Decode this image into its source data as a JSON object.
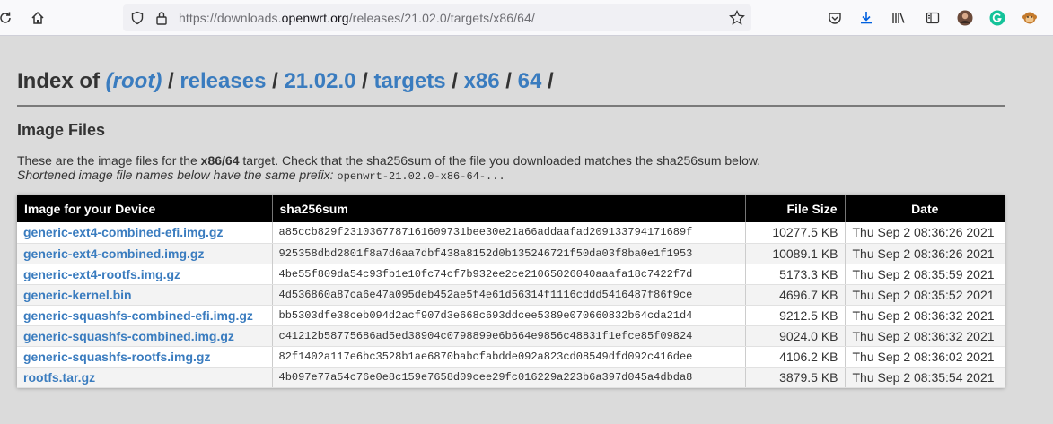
{
  "browser": {
    "url_prefix": "https://downloads.",
    "url_domain": "openwrt.org",
    "url_path": "/releases/21.02.0/targets/x86/64/"
  },
  "page": {
    "heading_prefix": "Index of ",
    "crumbs": [
      "(root)",
      "releases",
      "21.02.0",
      "targets",
      "x86",
      "64"
    ],
    "separator": " / ",
    "trailing": " /",
    "section_title": "Image Files",
    "desc_pre": "These are the image files for the ",
    "desc_target": "x86/64",
    "desc_post": " target. Check that the sha256sum of the file you downloaded matches the sha256sum below.",
    "desc_sub": "Shortened image file names below have the same prefix: ",
    "desc_prefix_code": "openwrt-21.02.0-x86-64-..."
  },
  "table": {
    "headers": {
      "device": "Image for your Device",
      "sha": "sha256sum",
      "size": "File Size",
      "date": "Date"
    },
    "rows": [
      {
        "name": "generic-ext4-combined-efi.img.gz",
        "sha": "a85ccb829f2310367787161609731bee30e21a66addaafad209133794171689f",
        "size": "10277.5 KB",
        "date": "Thu Sep 2 08:36:26 2021"
      },
      {
        "name": "generic-ext4-combined.img.gz",
        "sha": "925358dbd2801f8a7d6aa7dbf438a8152d0b135246721f50da03f8ba0e1f1953",
        "size": "10089.1 KB",
        "date": "Thu Sep 2 08:36:26 2021"
      },
      {
        "name": "generic-ext4-rootfs.img.gz",
        "sha": "4be55f809da54c93fb1e10fc74cf7b932ee2ce21065026040aaafa18c7422f7d",
        "size": "5173.3 KB",
        "date": "Thu Sep 2 08:35:59 2021"
      },
      {
        "name": "generic-kernel.bin",
        "sha": "4d536860a87ca6e47a095deb452ae5f4e61d56314f1116cddd5416487f86f9ce",
        "size": "4696.7 KB",
        "date": "Thu Sep 2 08:35:52 2021"
      },
      {
        "name": "generic-squashfs-combined-efi.img.gz",
        "sha": "bb5303dfe38ceb094d2acf907d3e668c693ddcee5389e070660832b64cda21d4",
        "size": "9212.5 KB",
        "date": "Thu Sep 2 08:36:32 2021"
      },
      {
        "name": "generic-squashfs-combined.img.gz",
        "sha": "c41212b58775686ad5ed38904c0798899e6b664e9856c48831f1efce85f09824",
        "size": "9024.0 KB",
        "date": "Thu Sep 2 08:36:32 2021"
      },
      {
        "name": "generic-squashfs-rootfs.img.gz",
        "sha": "82f1402a117e6bc3528b1ae6870babcfabdde092a823cd08549dfd092c416dee",
        "size": "4106.2 KB",
        "date": "Thu Sep 2 08:36:02 2021"
      },
      {
        "name": "rootfs.tar.gz",
        "sha": "4b097e77a54c76e0e8c159e7658d09cee29fc016229a223b6a397d045a4dbda8",
        "size": "3879.5 KB",
        "date": "Thu Sep 2 08:35:54 2021"
      }
    ]
  },
  "icons": [
    "reload-icon",
    "home-icon",
    "shield-icon",
    "lock-icon",
    "bookmark-star-icon",
    "pocket-icon",
    "download-icon",
    "library-icon",
    "reader-view-icon",
    "avatar",
    "grammarly-icon",
    "monkey-extension-icon"
  ],
  "colors": {
    "link": "#3a7cbf",
    "header_bg": "#000000",
    "page_bg": "#dbdbdb"
  }
}
